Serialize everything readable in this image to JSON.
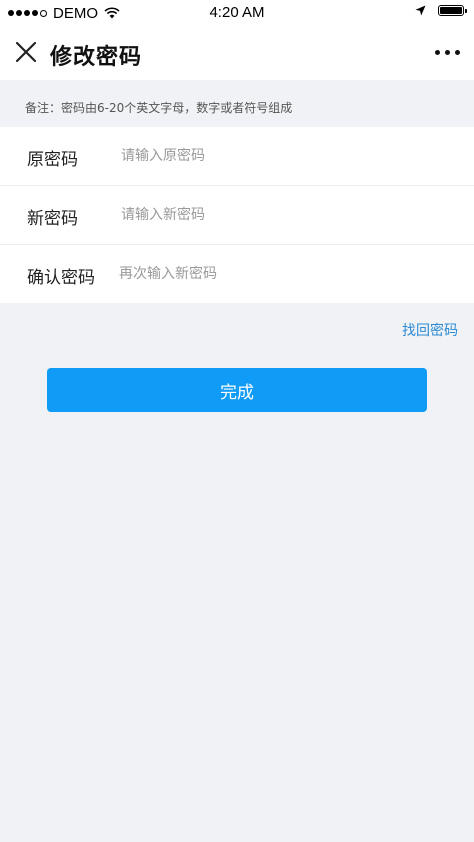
{
  "status_bar": {
    "carrier": "DEMO",
    "time": "4:20 AM",
    "signal_bars_filled": 4,
    "signal_bars_total": 5,
    "battery_level": 1.0
  },
  "nav": {
    "title": "修改密码",
    "close_icon": "close-icon",
    "more_icon": "more-icon"
  },
  "note": "备注：密码由6-20个英文字母，数字或者符号组成",
  "form": {
    "old_password": {
      "label": "原密码",
      "placeholder": "请输入原密码",
      "value": ""
    },
    "new_password": {
      "label": "新密码",
      "placeholder": "请输入新密码",
      "value": ""
    },
    "confirm_password": {
      "label": "确认密码",
      "placeholder": "再次输入新密码",
      "value": ""
    }
  },
  "forgot_link": "找回密码",
  "submit_label": "完成",
  "colors": {
    "accent": "#0f9bf6",
    "link": "#2a8ad4",
    "background": "#f1f2f5"
  }
}
